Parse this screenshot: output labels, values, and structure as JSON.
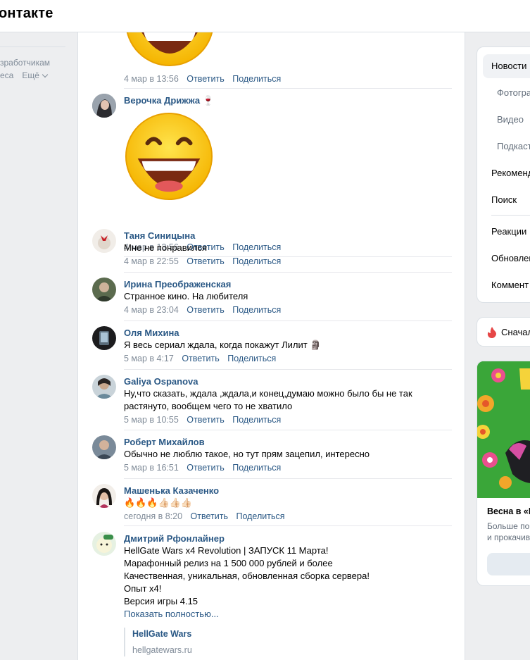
{
  "header": {
    "logo_text": "онтакте"
  },
  "leftnav": {
    "dev_link": "зработчикам",
    "biz_link": "еса",
    "more_label": "Ещё"
  },
  "labels": {
    "reply": "Ответить",
    "share": "Поделиться"
  },
  "comments": [
    {
      "time": "4 мар в 13:56"
    },
    {
      "author": "Верочка Дрижжа",
      "author_emoji": "🍷",
      "time": "4 мар в 13:56"
    },
    {
      "author": "Таня Синицына",
      "text": "Мне не понравился",
      "time": "4 мар в 22:55"
    },
    {
      "author": "Ирина Преображенская",
      "text": "Странное кино. На любителя",
      "time": "4 мар в 23:04"
    },
    {
      "author": "Оля Михина",
      "text": "Я весь сериал ждала, когда покажут Лилит",
      "text_emoji": "🗿",
      "time": "5 мар в 4:17"
    },
    {
      "author": "Galiya Ospanova",
      "text": "Ну,что сказать, ждала ,ждала,и конец,думаю можно было бы не так растянуто, вообщем чего то не хватило",
      "time": "5 мар в 10:55"
    },
    {
      "author": "Роберт Михайлов",
      "text": "Обычно не люблю такое, но тут прям зацепил, интересно",
      "time": "5 мар в 16:51"
    },
    {
      "author": "Машенька Казаченко",
      "text": "🔥🔥🔥👍🏻👍🏻👍🏻",
      "time": "сегодня в 8:20"
    },
    {
      "author": "Дмитрий Рфонлайнер",
      "lines": [
        "HellGate Wars x4 Revolution | ЗАПУСК 11 Марта!",
        "Марафонный релиз на 1 500 000 рублей и более",
        "Качественная, уникальная, обновленная сборка сервера!",
        "Опыт х4!",
        "Версия игры 4.15"
      ],
      "show_more": "Показать полностью...",
      "link_title": "HellGate Wars",
      "link_url": "hellgatewars.ru"
    }
  ],
  "rightmenu": {
    "items": [
      "Новости",
      "Фотогра",
      "Видео",
      "Подкаст",
      "Рекоменд",
      "Поиск",
      "Реакции",
      "Обновлен",
      "Коммент"
    ],
    "pill_label": "Сначал"
  },
  "ad": {
    "title": "Весна в «М",
    "desc1": "Больше по",
    "desc2": "и прокачив"
  },
  "colors": {
    "link": "#2a5885",
    "meta": "#818c99",
    "bg": "#edeef0"
  }
}
